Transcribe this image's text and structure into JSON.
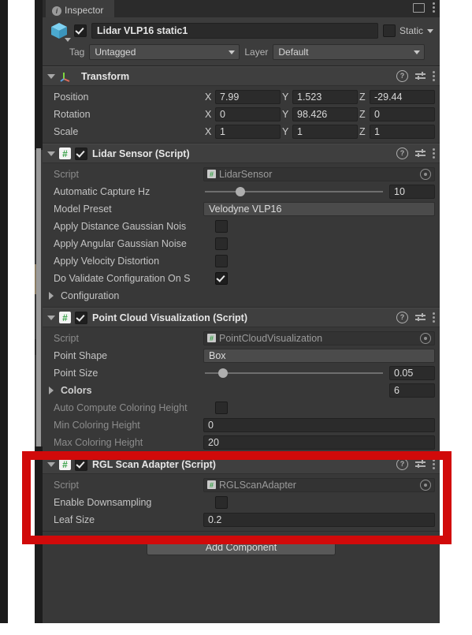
{
  "window": {
    "tab_label": "Inspector",
    "tab_icon": "info-icon",
    "window_icon": "window-icon",
    "menu_icon": "kebab-menu-icon"
  },
  "gameobject": {
    "icon": "cube-icon",
    "enabled": true,
    "name": "Lidar VLP16 static1",
    "static_label": "Static",
    "static_checked": false,
    "tag_label": "Tag",
    "tag_value": "Untagged",
    "layer_label": "Layer",
    "layer_value": "Default"
  },
  "components": [
    {
      "title": "Transform",
      "icon": "transform-icon",
      "expanded": true,
      "has_enable_toggle": false,
      "vectors": [
        {
          "label": "Position",
          "x": "7.99",
          "y": "1.523",
          "z": "-29.44"
        },
        {
          "label": "Rotation",
          "x": "0",
          "y": "98.426",
          "z": "0"
        },
        {
          "label": "Scale",
          "x": "1",
          "y": "1",
          "z": "1"
        }
      ]
    },
    {
      "title": "Lidar Sensor (Script)",
      "icon": "script-icon",
      "expanded": true,
      "enabled": true,
      "rows": [
        {
          "kind": "object",
          "label": "Script",
          "value": "LidarSensor",
          "dim": true
        },
        {
          "kind": "slider",
          "label": "Automatic Capture Hz",
          "value": "10",
          "pos": 20
        },
        {
          "kind": "dropdown",
          "label": "Model Preset",
          "value": "Velodyne VLP16"
        },
        {
          "kind": "checkbox",
          "label": "Apply Distance Gaussian Nois",
          "checked": false
        },
        {
          "kind": "checkbox",
          "label": "Apply Angular Gaussian Noise",
          "checked": false
        },
        {
          "kind": "checkbox",
          "label": "Apply Velocity Distortion",
          "checked": false
        },
        {
          "kind": "checkbox",
          "label": "Do Validate Configuration On S",
          "checked": true
        },
        {
          "kind": "foldout",
          "label": "Configuration"
        }
      ]
    },
    {
      "title": "Point Cloud Visualization (Script)",
      "icon": "script-icon",
      "expanded": true,
      "enabled": true,
      "rows": [
        {
          "kind": "object",
          "label": "Script",
          "value": "PointCloudVisualization",
          "dim": true
        },
        {
          "kind": "dropdown",
          "label": "Point Shape",
          "value": "Box"
        },
        {
          "kind": "slider",
          "label": "Point Size",
          "value": "0.05",
          "pos": 10
        },
        {
          "kind": "foldout-count",
          "label": "Colors",
          "value": "6"
        },
        {
          "kind": "checkbox",
          "label": "Auto Compute Coloring Height",
          "checked": false
        },
        {
          "kind": "text",
          "label": "Min Coloring Height",
          "value": "0"
        },
        {
          "kind": "text",
          "label": "Max Coloring Height",
          "value": "20"
        }
      ]
    },
    {
      "title": "RGL Scan Adapter (Script)",
      "icon": "script-icon",
      "expanded": true,
      "enabled": true,
      "highlighted": true,
      "rows": [
        {
          "kind": "object",
          "label": "Script",
          "value": "RGLScanAdapter",
          "dim": true
        },
        {
          "kind": "checkbox",
          "label": "Enable Downsampling",
          "checked": false
        },
        {
          "kind": "text",
          "label": "Leaf Size",
          "value": "0.2"
        }
      ]
    }
  ],
  "footer": {
    "add_component_label": "Add Component"
  },
  "annotation": {
    "color": "#d10a0a",
    "target": "RGL Scan Adapter (Script)"
  },
  "axis_labels": {
    "x": "X",
    "y": "Y",
    "z": "Z"
  },
  "icon_glyphs": {
    "help": "?",
    "script_hash": "#",
    "info": "i"
  }
}
